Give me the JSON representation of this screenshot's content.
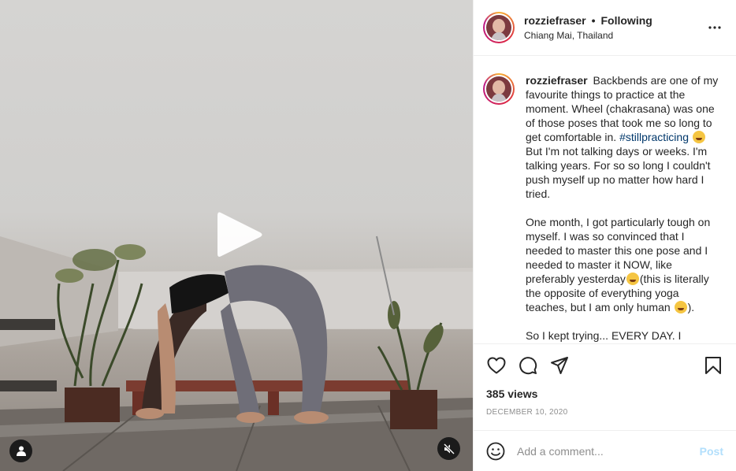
{
  "header": {
    "username": "rozziefraser",
    "separator": "•",
    "follow_label": "Following",
    "location": "Chiang Mai, Thailand"
  },
  "caption": {
    "username": "rozziefraser",
    "p1_a": "Backbends are one of my favourite things to practice at the moment. Wheel (chakrasana) was one of those poses that took me so long to get comfortable in.",
    "hashtag": "#stillpracticing",
    "p1_b": "But I'm not talking days or weeks. I'm talking years. For so so long I couldn't push myself up no matter how hard I tried.",
    "p2_a": "One month, I got particularly tough on myself. I was so convinced that I needed to master this one pose and I needed to master it NOW, like preferably yesterday",
    "p2_b": "(this is literally the opposite of everything yoga teaches, but I am only human",
    "p2_c": ").",
    "p3": "So I kept trying... EVERY DAY. I"
  },
  "stats": {
    "views": "385 views",
    "date": "DECEMBER 10, 2020"
  },
  "comment_box": {
    "placeholder": "Add a comment...",
    "post_label": "Post"
  },
  "icons": {
    "play": "play-icon",
    "user_tag": "user-tag-icon",
    "mute": "muted-speaker-icon",
    "more": "more-options-icon",
    "like": "heart-icon",
    "comment": "comment-icon",
    "share": "share-icon",
    "save": "bookmark-icon",
    "emoji": "emoji-icon"
  },
  "colors": {
    "hashtag": "#00376b",
    "post_disabled": "#b2dffc",
    "meta_grey": "#8e8e8e"
  }
}
